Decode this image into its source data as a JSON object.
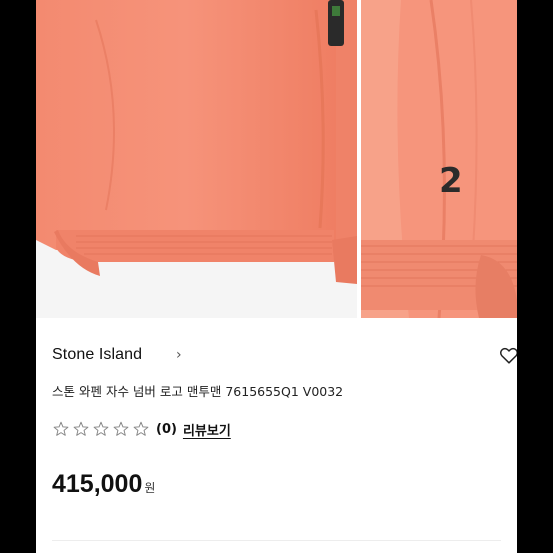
{
  "product": {
    "brand": "Stone Island",
    "brand_chevron": "›",
    "name": "스톤 와펜 자수 넘버 로고 맨투맨 7615655Q1 V0032",
    "rating": {
      "stars_filled": 0,
      "stars_total": 5,
      "count_text": "(0)",
      "review_link": "리뷰보기"
    },
    "price": "415,000",
    "currency": "원",
    "detail_number": "2"
  },
  "icons": {
    "wishlist": "heart-outline-icon",
    "star": "star-outline-icon"
  },
  "colors": {
    "garment": "#f4866c",
    "garment_shadow": "#d9634f",
    "background": "#000000",
    "panel": "#ffffff",
    "text": "#111111"
  }
}
